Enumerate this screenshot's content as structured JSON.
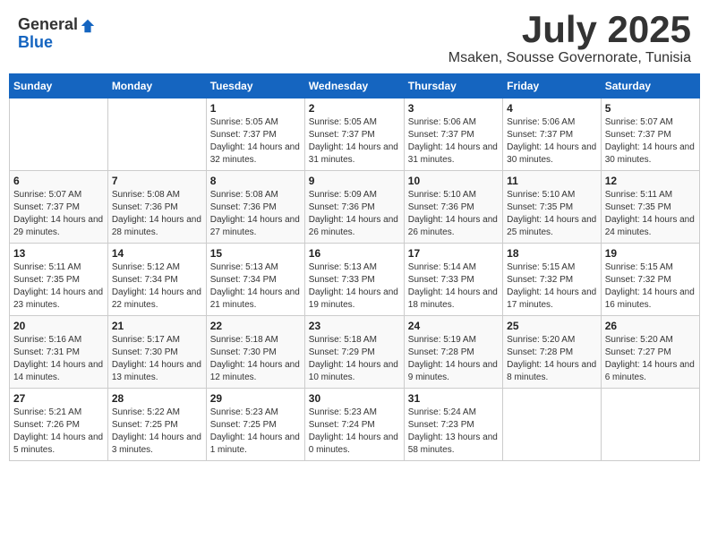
{
  "logo": {
    "general": "General",
    "blue": "Blue"
  },
  "title": "July 2025",
  "subtitle": "Msaken, Sousse Governorate, Tunisia",
  "headers": [
    "Sunday",
    "Monday",
    "Tuesday",
    "Wednesday",
    "Thursday",
    "Friday",
    "Saturday"
  ],
  "weeks": [
    [
      {
        "day": "",
        "info": ""
      },
      {
        "day": "",
        "info": ""
      },
      {
        "day": "1",
        "info": "Sunrise: 5:05 AM\nSunset: 7:37 PM\nDaylight: 14 hours and 32 minutes."
      },
      {
        "day": "2",
        "info": "Sunrise: 5:05 AM\nSunset: 7:37 PM\nDaylight: 14 hours and 31 minutes."
      },
      {
        "day": "3",
        "info": "Sunrise: 5:06 AM\nSunset: 7:37 PM\nDaylight: 14 hours and 31 minutes."
      },
      {
        "day": "4",
        "info": "Sunrise: 5:06 AM\nSunset: 7:37 PM\nDaylight: 14 hours and 30 minutes."
      },
      {
        "day": "5",
        "info": "Sunrise: 5:07 AM\nSunset: 7:37 PM\nDaylight: 14 hours and 30 minutes."
      }
    ],
    [
      {
        "day": "6",
        "info": "Sunrise: 5:07 AM\nSunset: 7:37 PM\nDaylight: 14 hours and 29 minutes."
      },
      {
        "day": "7",
        "info": "Sunrise: 5:08 AM\nSunset: 7:36 PM\nDaylight: 14 hours and 28 minutes."
      },
      {
        "day": "8",
        "info": "Sunrise: 5:08 AM\nSunset: 7:36 PM\nDaylight: 14 hours and 27 minutes."
      },
      {
        "day": "9",
        "info": "Sunrise: 5:09 AM\nSunset: 7:36 PM\nDaylight: 14 hours and 26 minutes."
      },
      {
        "day": "10",
        "info": "Sunrise: 5:10 AM\nSunset: 7:36 PM\nDaylight: 14 hours and 26 minutes."
      },
      {
        "day": "11",
        "info": "Sunrise: 5:10 AM\nSunset: 7:35 PM\nDaylight: 14 hours and 25 minutes."
      },
      {
        "day": "12",
        "info": "Sunrise: 5:11 AM\nSunset: 7:35 PM\nDaylight: 14 hours and 24 minutes."
      }
    ],
    [
      {
        "day": "13",
        "info": "Sunrise: 5:11 AM\nSunset: 7:35 PM\nDaylight: 14 hours and 23 minutes."
      },
      {
        "day": "14",
        "info": "Sunrise: 5:12 AM\nSunset: 7:34 PM\nDaylight: 14 hours and 22 minutes."
      },
      {
        "day": "15",
        "info": "Sunrise: 5:13 AM\nSunset: 7:34 PM\nDaylight: 14 hours and 21 minutes."
      },
      {
        "day": "16",
        "info": "Sunrise: 5:13 AM\nSunset: 7:33 PM\nDaylight: 14 hours and 19 minutes."
      },
      {
        "day": "17",
        "info": "Sunrise: 5:14 AM\nSunset: 7:33 PM\nDaylight: 14 hours and 18 minutes."
      },
      {
        "day": "18",
        "info": "Sunrise: 5:15 AM\nSunset: 7:32 PM\nDaylight: 14 hours and 17 minutes."
      },
      {
        "day": "19",
        "info": "Sunrise: 5:15 AM\nSunset: 7:32 PM\nDaylight: 14 hours and 16 minutes."
      }
    ],
    [
      {
        "day": "20",
        "info": "Sunrise: 5:16 AM\nSunset: 7:31 PM\nDaylight: 14 hours and 14 minutes."
      },
      {
        "day": "21",
        "info": "Sunrise: 5:17 AM\nSunset: 7:30 PM\nDaylight: 14 hours and 13 minutes."
      },
      {
        "day": "22",
        "info": "Sunrise: 5:18 AM\nSunset: 7:30 PM\nDaylight: 14 hours and 12 minutes."
      },
      {
        "day": "23",
        "info": "Sunrise: 5:18 AM\nSunset: 7:29 PM\nDaylight: 14 hours and 10 minutes."
      },
      {
        "day": "24",
        "info": "Sunrise: 5:19 AM\nSunset: 7:28 PM\nDaylight: 14 hours and 9 minutes."
      },
      {
        "day": "25",
        "info": "Sunrise: 5:20 AM\nSunset: 7:28 PM\nDaylight: 14 hours and 8 minutes."
      },
      {
        "day": "26",
        "info": "Sunrise: 5:20 AM\nSunset: 7:27 PM\nDaylight: 14 hours and 6 minutes."
      }
    ],
    [
      {
        "day": "27",
        "info": "Sunrise: 5:21 AM\nSunset: 7:26 PM\nDaylight: 14 hours and 5 minutes."
      },
      {
        "day": "28",
        "info": "Sunrise: 5:22 AM\nSunset: 7:25 PM\nDaylight: 14 hours and 3 minutes."
      },
      {
        "day": "29",
        "info": "Sunrise: 5:23 AM\nSunset: 7:25 PM\nDaylight: 14 hours and 1 minute."
      },
      {
        "day": "30",
        "info": "Sunrise: 5:23 AM\nSunset: 7:24 PM\nDaylight: 14 hours and 0 minutes."
      },
      {
        "day": "31",
        "info": "Sunrise: 5:24 AM\nSunset: 7:23 PM\nDaylight: 13 hours and 58 minutes."
      },
      {
        "day": "",
        "info": ""
      },
      {
        "day": "",
        "info": ""
      }
    ]
  ]
}
